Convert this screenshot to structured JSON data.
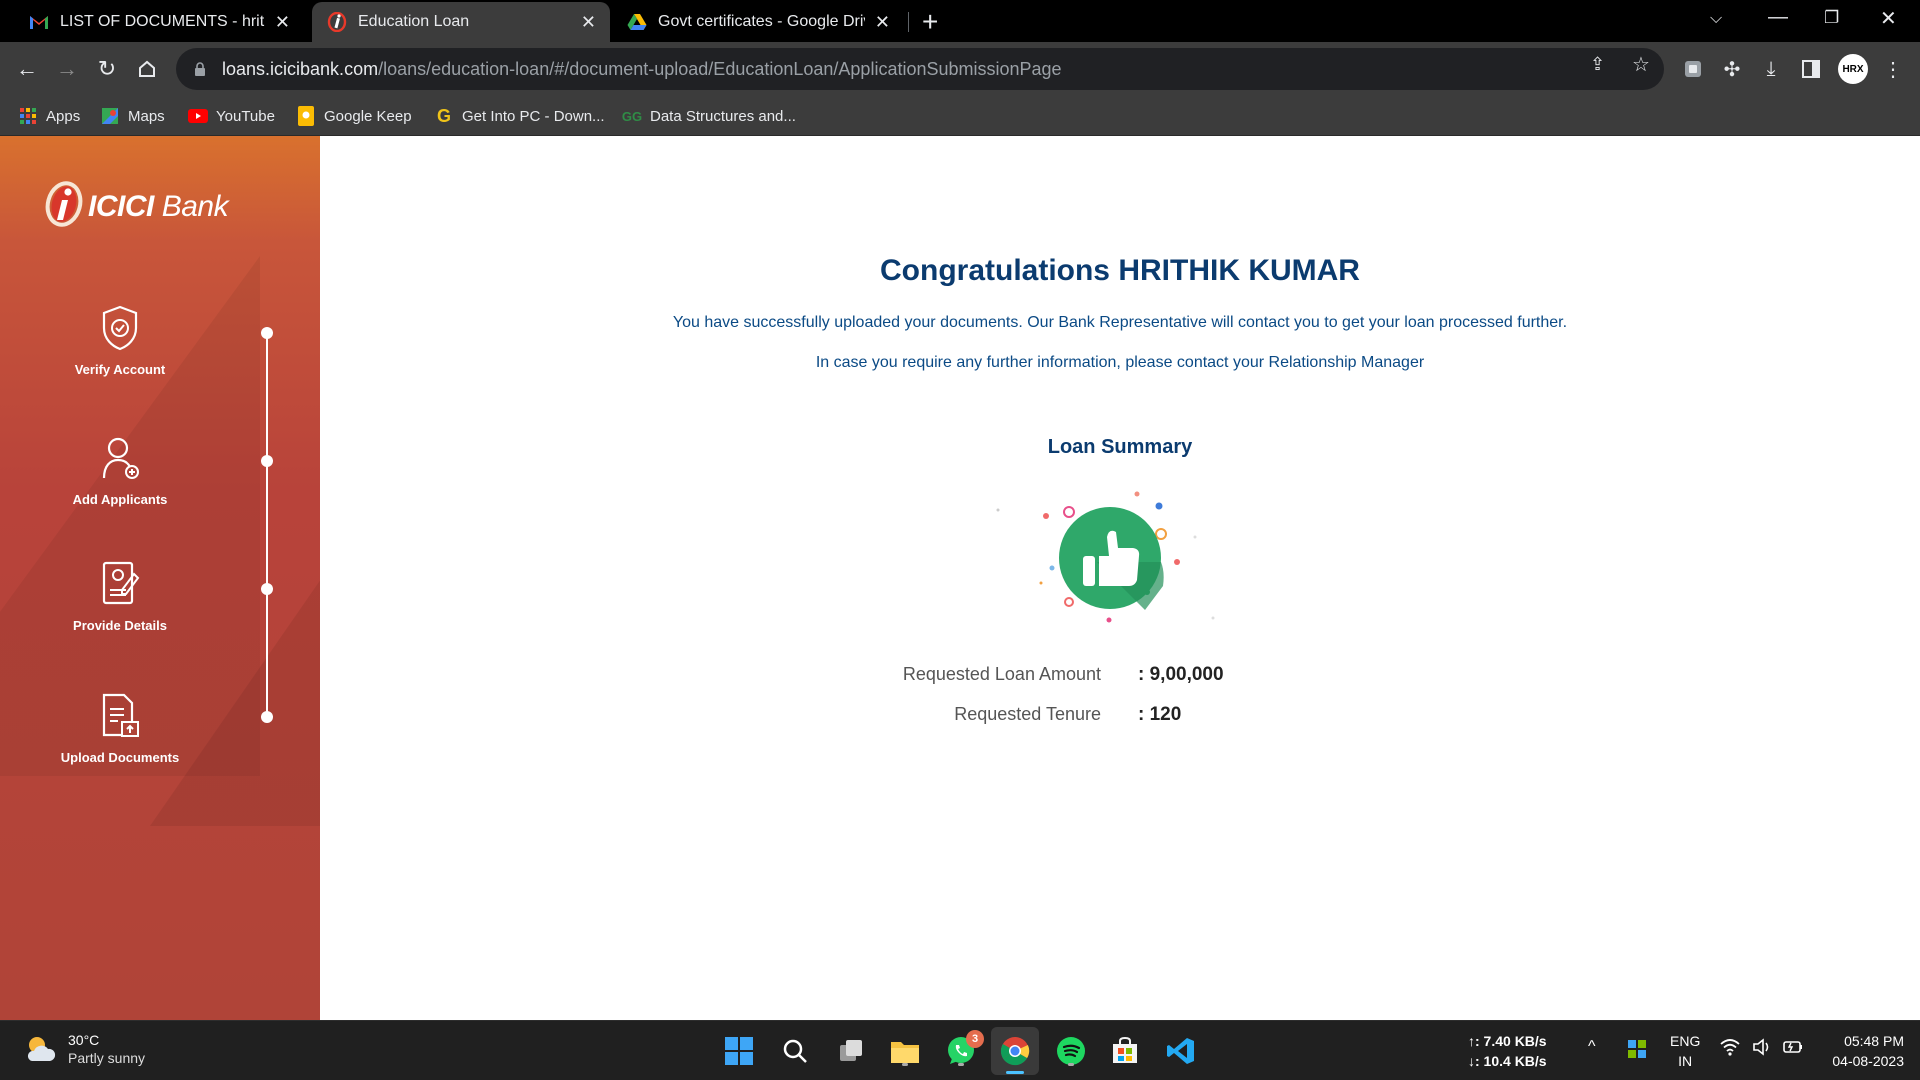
{
  "browser": {
    "tabs": [
      {
        "title": "LIST OF DOCUMENTS - hrithikku",
        "favicon": "gmail-icon",
        "active": false
      },
      {
        "title": "Education Loan",
        "favicon": "icici-icon",
        "active": true
      },
      {
        "title": "Govt certificates - Google Drive",
        "favicon": "google-drive-icon",
        "active": false
      }
    ],
    "url_host": "loans.icicibank.com",
    "url_path": "/loans/education-loan/#/document-upload/EducationLoan/ApplicationSubmissionPage",
    "profile_initials": "HRX",
    "bookmarks": [
      {
        "label": "Apps",
        "icon": "apps-grid-icon"
      },
      {
        "label": "Maps",
        "icon": "maps-icon"
      },
      {
        "label": "YouTube",
        "icon": "youtube-icon"
      },
      {
        "label": "Google Keep",
        "icon": "keep-icon"
      },
      {
        "label": "Get Into PC - Down...",
        "icon": "getintopc-icon"
      },
      {
        "label": "Data Structures and...",
        "icon": "gfg-icon"
      }
    ]
  },
  "sidebar": {
    "logo_text": "ICICI",
    "logo_bank": "Bank",
    "steps": [
      {
        "label": "Verify Account",
        "icon": "shield-check-icon"
      },
      {
        "label": "Add Applicants",
        "icon": "add-person-icon"
      },
      {
        "label": "Provide Details",
        "icon": "form-details-icon"
      },
      {
        "label": "Upload Documents",
        "icon": "upload-document-icon"
      }
    ]
  },
  "main": {
    "title": "Congratulations HRITHIK KUMAR",
    "message1": "You have successfully uploaded your documents. Our Bank Representative will contact you to get your loan processed further.",
    "message2": "In case you require any further information, please contact your Relationship Manager",
    "summary_title": "Loan Summary",
    "summary": [
      {
        "label": "Requested Loan Amount",
        "value": ": 9,00,000"
      },
      {
        "label": "Requested Tenure",
        "value": ": 120"
      }
    ]
  },
  "taskbar": {
    "weather_temp": "30°C",
    "weather_desc": "Partly sunny",
    "whatsapp_badge": "3",
    "net_up": "↑: 7.40 KB/s",
    "net_down": "↓: 10.4 KB/s",
    "lang_top": "ENG",
    "lang_bottom": "IN",
    "time": "05:48 PM",
    "date": "04-08-2023"
  },
  "colors": {
    "brand_primary": "#b8433a",
    "brand_orange": "#d9712e",
    "heading_blue": "#0b3b6f",
    "success_green": "#2fa86a"
  }
}
